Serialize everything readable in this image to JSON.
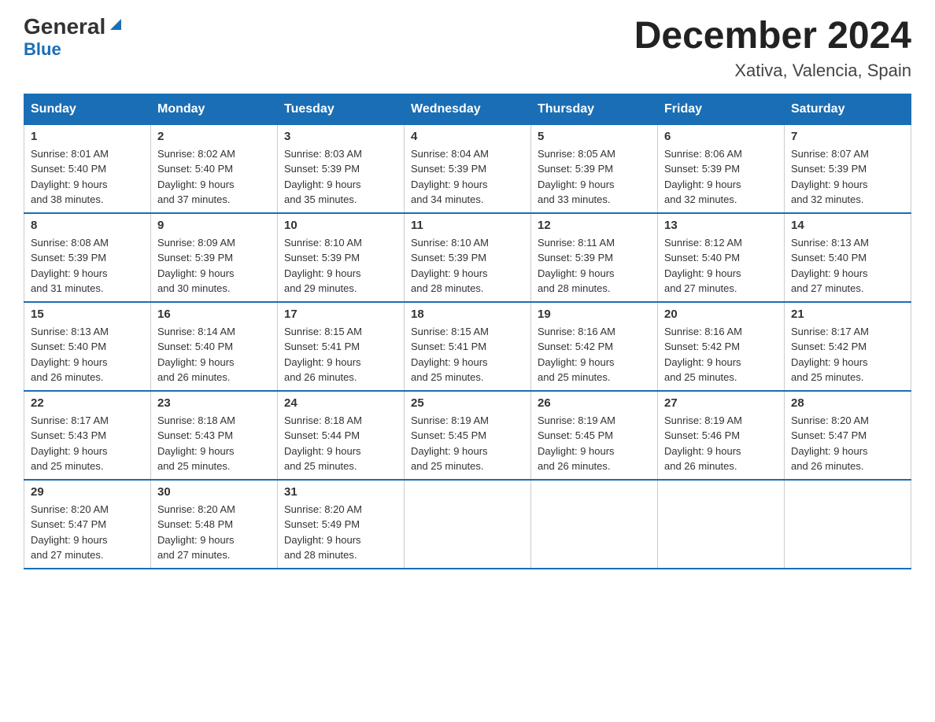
{
  "logo": {
    "general": "General",
    "blue": "Blue",
    "triangle": "▲"
  },
  "title": "December 2024",
  "location": "Xativa, Valencia, Spain",
  "days_of_week": [
    "Sunday",
    "Monday",
    "Tuesday",
    "Wednesday",
    "Thursday",
    "Friday",
    "Saturday"
  ],
  "weeks": [
    [
      {
        "day": "1",
        "sunrise": "8:01 AM",
        "sunset": "5:40 PM",
        "daylight": "9 hours and 38 minutes."
      },
      {
        "day": "2",
        "sunrise": "8:02 AM",
        "sunset": "5:40 PM",
        "daylight": "9 hours and 37 minutes."
      },
      {
        "day": "3",
        "sunrise": "8:03 AM",
        "sunset": "5:39 PM",
        "daylight": "9 hours and 35 minutes."
      },
      {
        "day": "4",
        "sunrise": "8:04 AM",
        "sunset": "5:39 PM",
        "daylight": "9 hours and 34 minutes."
      },
      {
        "day": "5",
        "sunrise": "8:05 AM",
        "sunset": "5:39 PM",
        "daylight": "9 hours and 33 minutes."
      },
      {
        "day": "6",
        "sunrise": "8:06 AM",
        "sunset": "5:39 PM",
        "daylight": "9 hours and 32 minutes."
      },
      {
        "day": "7",
        "sunrise": "8:07 AM",
        "sunset": "5:39 PM",
        "daylight": "9 hours and 32 minutes."
      }
    ],
    [
      {
        "day": "8",
        "sunrise": "8:08 AM",
        "sunset": "5:39 PM",
        "daylight": "9 hours and 31 minutes."
      },
      {
        "day": "9",
        "sunrise": "8:09 AM",
        "sunset": "5:39 PM",
        "daylight": "9 hours and 30 minutes."
      },
      {
        "day": "10",
        "sunrise": "8:10 AM",
        "sunset": "5:39 PM",
        "daylight": "9 hours and 29 minutes."
      },
      {
        "day": "11",
        "sunrise": "8:10 AM",
        "sunset": "5:39 PM",
        "daylight": "9 hours and 28 minutes."
      },
      {
        "day": "12",
        "sunrise": "8:11 AM",
        "sunset": "5:39 PM",
        "daylight": "9 hours and 28 minutes."
      },
      {
        "day": "13",
        "sunrise": "8:12 AM",
        "sunset": "5:40 PM",
        "daylight": "9 hours and 27 minutes."
      },
      {
        "day": "14",
        "sunrise": "8:13 AM",
        "sunset": "5:40 PM",
        "daylight": "9 hours and 27 minutes."
      }
    ],
    [
      {
        "day": "15",
        "sunrise": "8:13 AM",
        "sunset": "5:40 PM",
        "daylight": "9 hours and 26 minutes."
      },
      {
        "day": "16",
        "sunrise": "8:14 AM",
        "sunset": "5:40 PM",
        "daylight": "9 hours and 26 minutes."
      },
      {
        "day": "17",
        "sunrise": "8:15 AM",
        "sunset": "5:41 PM",
        "daylight": "9 hours and 26 minutes."
      },
      {
        "day": "18",
        "sunrise": "8:15 AM",
        "sunset": "5:41 PM",
        "daylight": "9 hours and 25 minutes."
      },
      {
        "day": "19",
        "sunrise": "8:16 AM",
        "sunset": "5:42 PM",
        "daylight": "9 hours and 25 minutes."
      },
      {
        "day": "20",
        "sunrise": "8:16 AM",
        "sunset": "5:42 PM",
        "daylight": "9 hours and 25 minutes."
      },
      {
        "day": "21",
        "sunrise": "8:17 AM",
        "sunset": "5:42 PM",
        "daylight": "9 hours and 25 minutes."
      }
    ],
    [
      {
        "day": "22",
        "sunrise": "8:17 AM",
        "sunset": "5:43 PM",
        "daylight": "9 hours and 25 minutes."
      },
      {
        "day": "23",
        "sunrise": "8:18 AM",
        "sunset": "5:43 PM",
        "daylight": "9 hours and 25 minutes."
      },
      {
        "day": "24",
        "sunrise": "8:18 AM",
        "sunset": "5:44 PM",
        "daylight": "9 hours and 25 minutes."
      },
      {
        "day": "25",
        "sunrise": "8:19 AM",
        "sunset": "5:45 PM",
        "daylight": "9 hours and 25 minutes."
      },
      {
        "day": "26",
        "sunrise": "8:19 AM",
        "sunset": "5:45 PM",
        "daylight": "9 hours and 26 minutes."
      },
      {
        "day": "27",
        "sunrise": "8:19 AM",
        "sunset": "5:46 PM",
        "daylight": "9 hours and 26 minutes."
      },
      {
        "day": "28",
        "sunrise": "8:20 AM",
        "sunset": "5:47 PM",
        "daylight": "9 hours and 26 minutes."
      }
    ],
    [
      {
        "day": "29",
        "sunrise": "8:20 AM",
        "sunset": "5:47 PM",
        "daylight": "9 hours and 27 minutes."
      },
      {
        "day": "30",
        "sunrise": "8:20 AM",
        "sunset": "5:48 PM",
        "daylight": "9 hours and 27 minutes."
      },
      {
        "day": "31",
        "sunrise": "8:20 AM",
        "sunset": "5:49 PM",
        "daylight": "9 hours and 28 minutes."
      },
      null,
      null,
      null,
      null
    ]
  ],
  "labels": {
    "sunrise": "Sunrise:",
    "sunset": "Sunset:",
    "daylight": "Daylight:"
  }
}
